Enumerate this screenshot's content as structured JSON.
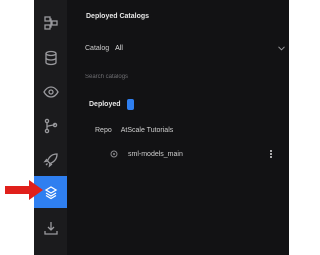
{
  "panel": {
    "title": "Deployed Catalogs",
    "catalog_label": "Catalog",
    "catalog_value": "All",
    "search_placeholder": "Search catalogs",
    "deployed_label": "Deployed"
  },
  "repo": {
    "label": "Repo",
    "name": "AtScale Tutorials",
    "model_name": "sml-models_main"
  },
  "rail": {
    "icons": [
      "diagram-icon",
      "database-icon",
      "eye-icon",
      "git-branch-icon",
      "rocket-icon",
      "deployed-catalogs-icon",
      "download-icon"
    ],
    "active": "deployed-catalogs-icon"
  },
  "colors": {
    "accent": "#2f7ff0",
    "panel_bg": "#121214",
    "rail_bg": "#1b1b1d",
    "pointer_arrow": "#e0201b"
  }
}
